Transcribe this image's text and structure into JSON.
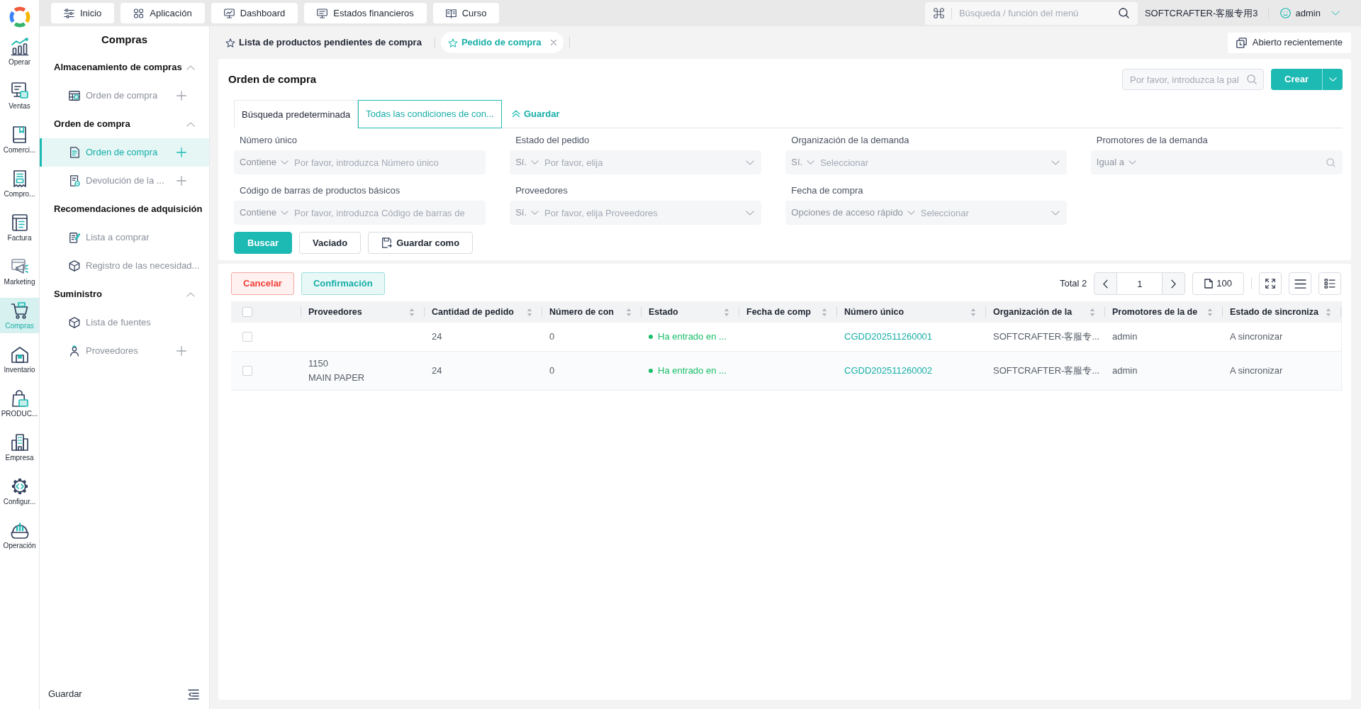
{
  "rail": {
    "items": [
      {
        "label": "Operar",
        "selected": false
      },
      {
        "label": "Ventas",
        "selected": false
      },
      {
        "label": "Comerci...",
        "selected": false
      },
      {
        "label": "Compro...",
        "selected": false
      },
      {
        "label": "Factura",
        "selected": false
      },
      {
        "label": "Marketing",
        "selected": false
      },
      {
        "label": "Compras",
        "selected": true
      },
      {
        "label": "Inventario",
        "selected": false
      },
      {
        "label": "PRODUC...",
        "selected": false
      },
      {
        "label": "Empresa",
        "selected": false
      },
      {
        "label": "Configur...",
        "selected": false
      },
      {
        "label": "Operación",
        "selected": false
      }
    ]
  },
  "top_bar": {
    "tabs": [
      "Inicio",
      "Aplicación",
      "Dashboard",
      "Estados financieros",
      "Curso"
    ],
    "search": {
      "placeholder": "Búsqueda / función del menú"
    },
    "organization": "SOFTCRAFTER-客服专用3",
    "user": "admin"
  },
  "sidebar": {
    "title": "Compras",
    "sections": [
      {
        "title": "Almacenamiento de compras",
        "expanded": true,
        "toggle": true,
        "items": [
          {
            "label": "Orden de compra",
            "selected": false,
            "add_button": true
          }
        ]
      },
      {
        "title": "Orden de compra",
        "expanded": true,
        "toggle": true,
        "items": [
          {
            "label": "Orden de compra",
            "selected": true,
            "add_button": true
          },
          {
            "label": "Devolución de la ...",
            "selected": false,
            "add_button": true
          }
        ]
      },
      {
        "title": "Recomendaciones de adquisición",
        "expanded": true,
        "toggle": false,
        "items": [
          {
            "label": "Lista a comprar",
            "selected": false,
            "add_button": false
          },
          {
            "label": "Registro de las necesidad...",
            "selected": false,
            "add_button": false
          }
        ]
      },
      {
        "title": "Suministro",
        "expanded": true,
        "toggle": true,
        "items": [
          {
            "label": "Lista de fuentes",
            "selected": false,
            "add_button": false
          },
          {
            "label": "Proveedores",
            "selected": false,
            "add_button": true
          }
        ]
      }
    ],
    "footer": "Guardar"
  },
  "page_tabs": [
    {
      "label": "Lista de productos pendientes de compra",
      "selected": false,
      "closable": false
    },
    {
      "label": "Pedido de compra",
      "selected": true,
      "closable": true
    }
  ],
  "recent_button": "Abierto recientemente",
  "query_panel": {
    "title": "Orden de compra",
    "search": {
      "placeholder": "Por favor, introduzca la pal"
    },
    "create_button": "Crear",
    "search_tabs": [
      {
        "label": "Búsqueda predeterminada",
        "selected": false
      },
      {
        "label": "Todas las condiciones de con...",
        "selected": true
      }
    ],
    "save_link": "Guardar",
    "filters": [
      {
        "label": "Número único",
        "kind": "text",
        "operator": "Contiene",
        "placeholder": "Por favor, introduzca Número único"
      },
      {
        "label": "Estado del pedido",
        "kind": "select",
        "operator": "Sí.",
        "placeholder": "Por favor, elija"
      },
      {
        "label": "Organización de la demanda",
        "kind": "select",
        "operator": "Sí.",
        "placeholder": "Seleccionar"
      },
      {
        "label": "Promotores de la demanda",
        "kind": "lookup",
        "operator": "Igual a"
      },
      {
        "label": "Código de barras de productos básicos",
        "kind": "text",
        "operator": "Contiene",
        "placeholder": "Por favor, introduzca Código de barras de"
      },
      {
        "label": "Proveedores",
        "kind": "select",
        "operator": "Sí.",
        "placeholder": "Por favor, elija Proveedores"
      },
      {
        "label": "Fecha de compra",
        "kind": "select",
        "operator": "Opciones de acceso rápido",
        "placeholder": "Seleccionar"
      }
    ],
    "buttons": [
      {
        "label": "Buscar",
        "kind": "primary"
      },
      {
        "label": "Vaciado",
        "kind": "plain"
      },
      {
        "label": "Guardar como",
        "kind": "save"
      }
    ]
  },
  "results_panel": {
    "actions": [
      {
        "label": "Cancelar",
        "kind": "danger"
      },
      {
        "label": "Confirmación",
        "kind": "confirm"
      }
    ],
    "total": "Total 2",
    "page": "1",
    "page_size": "100",
    "table": {
      "all_checked": false,
      "columns": [
        "Proveedores",
        "Cantidad de pedido",
        "Número de con",
        "Estado",
        "Fecha de comp",
        "Número único",
        "Organización de la",
        "Promotores de la de",
        "Estado de sincroniza"
      ],
      "rows": [
        {
          "checked": false,
          "cells": [
            {
              "kind": "empty"
            },
            {
              "kind": "text",
              "text": "24"
            },
            {
              "kind": "text",
              "text": "0"
            },
            {
              "kind": "status",
              "text": "Ha entrado en ...",
              "color": "#19be6b"
            },
            {
              "kind": "empty"
            },
            {
              "kind": "link",
              "text": "CGDD202511260001"
            },
            {
              "kind": "text",
              "text": "SOFTCRAFTER-客服专..."
            },
            {
              "kind": "text",
              "text": "admin"
            },
            {
              "kind": "text",
              "text": "A sincronizar"
            }
          ]
        },
        {
          "checked": false,
          "cells": [
            {
              "kind": "lines",
              "lines": [
                "1150",
                "MAIN PAPER"
              ]
            },
            {
              "kind": "text",
              "text": "24"
            },
            {
              "kind": "text",
              "text": "0"
            },
            {
              "kind": "status",
              "text": "Ha entrado en ...",
              "color": "#19be6b"
            },
            {
              "kind": "empty"
            },
            {
              "kind": "link",
              "text": "CGDD202511260002"
            },
            {
              "kind": "text",
              "text": "SOFTCRAFTER-客服专..."
            },
            {
              "kind": "text",
              "text": "admin"
            },
            {
              "kind": "text",
              "text": "A sincronizar"
            }
          ]
        }
      ]
    }
  }
}
